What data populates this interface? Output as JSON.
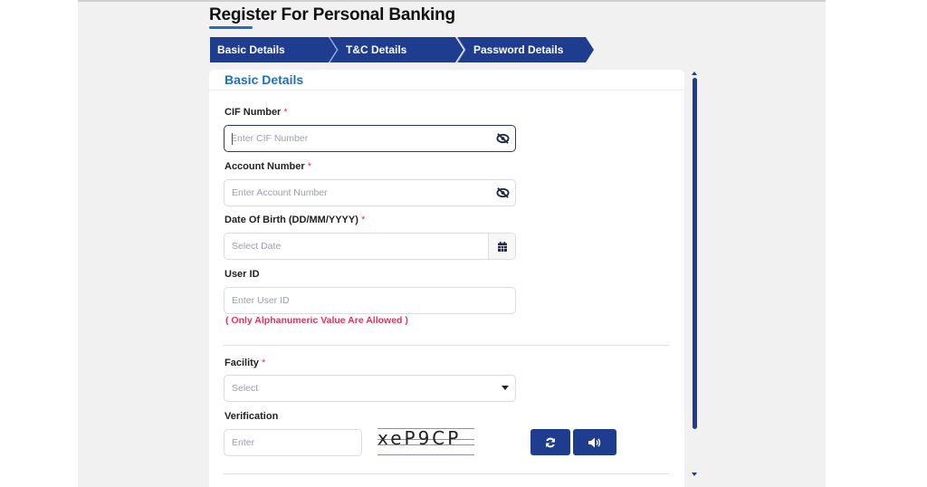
{
  "page": {
    "title": "Register For Personal Banking"
  },
  "stepper": {
    "steps": [
      {
        "label": "Basic Details",
        "active": true
      },
      {
        "label": "T&C Details",
        "active": false
      },
      {
        "label": "Password Details",
        "active": false
      }
    ]
  },
  "form": {
    "section_title": "Basic Details",
    "required_marker": "*",
    "cif": {
      "label": "CIF Number",
      "placeholder": "Enter CIF Number",
      "value": "",
      "toggle_icon": "eye-slash-icon"
    },
    "account": {
      "label": "Account Number",
      "placeholder": "Enter Account Number",
      "value": "",
      "toggle_icon": "eye-slash-icon"
    },
    "dob": {
      "label": "Date Of Birth (DD/MM/YYYY)",
      "placeholder": "Select Date",
      "value": "",
      "icon": "calendar-icon"
    },
    "user_id": {
      "label": "User ID",
      "placeholder": "Enter User ID",
      "value": "",
      "hint": "( Only Alphanumeric Value Are Allowed )"
    },
    "facility": {
      "label": "Facility",
      "selected": "Select"
    },
    "verification": {
      "label": "Verification",
      "placeholder": "Enter",
      "value": "",
      "captcha_text": "xeP9CP",
      "refresh_icon": "refresh-icon",
      "audio_icon": "volume-icon"
    }
  },
  "colors": {
    "primary": "#1f3d8f",
    "accent": "#1f6fbf",
    "error": "#e0355a",
    "background": "#f1f1f1"
  }
}
